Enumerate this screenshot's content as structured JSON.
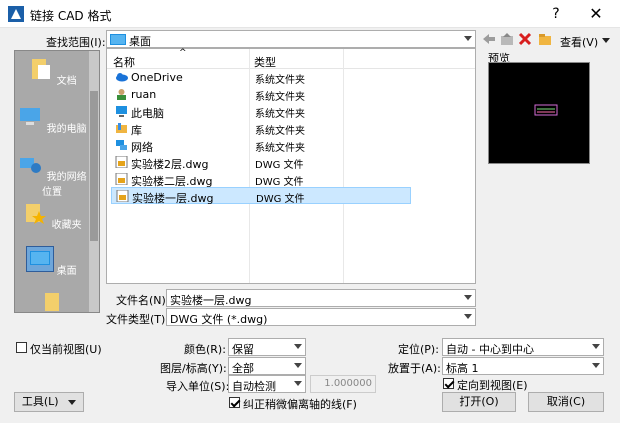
{
  "window": {
    "title": "链接 CAD 格式",
    "help": "?",
    "close": "✕"
  },
  "lookin": {
    "label": "查找范围(I):",
    "value": "桌面",
    "views_label": "查看(V)",
    "preview_label": "预览"
  },
  "places": [
    {
      "label": "文档",
      "icon": "documents-icon"
    },
    {
      "label": "我的电脑",
      "icon": "computer-icon"
    },
    {
      "label": "我的网络位置",
      "icon": "network-icon"
    },
    {
      "label": "收藏夹",
      "icon": "favorites-icon"
    },
    {
      "label": "桌面",
      "icon": "desktop-icon"
    }
  ],
  "files": {
    "col_name": "名称",
    "col_type": "类型",
    "rows": [
      {
        "name": "OneDrive",
        "type": "系统文件夹",
        "icon": "onedrive-icon"
      },
      {
        "name": "ruan",
        "type": "系统文件夹",
        "icon": "user-icon"
      },
      {
        "name": "此电脑",
        "type": "系统文件夹",
        "icon": "thispc-icon"
      },
      {
        "name": "库",
        "type": "系统文件夹",
        "icon": "library-icon"
      },
      {
        "name": "网络",
        "type": "系统文件夹",
        "icon": "network-icon"
      },
      {
        "name": "实验楼2层.dwg",
        "type": "DWG 文件",
        "icon": "dwg-icon"
      },
      {
        "name": "实验楼二层.dwg",
        "type": "DWG 文件",
        "icon": "dwg-icon"
      },
      {
        "name": "实验楼一层.dwg",
        "type": "DWG 文件",
        "icon": "dwg-icon",
        "selected": true
      }
    ]
  },
  "filename": {
    "label": "文件名(N):",
    "value": "实验楼一层.dwg"
  },
  "filetype": {
    "label": "文件类型(T):",
    "value": "DWG 文件 (*.dwg)"
  },
  "options": {
    "current_view_label": "仅当前视图(U)",
    "current_view_checked": false,
    "color_label": "颜色(R):",
    "color_value": "保留",
    "layers_label": "图层/标高(Y):",
    "layers_value": "全部",
    "units_label": "导入单位(S):",
    "units_value": "自动检测",
    "scale_value": "1.000000",
    "correct_lines_label": "纠正稍微偏离轴的线(F)",
    "correct_lines_checked": true,
    "position_label": "定位(P):",
    "position_value": "自动 - 中心到中心",
    "place_at_label": "放置于(A):",
    "place_at_value": "标高 1",
    "orient_label": "定向到视图(E)",
    "orient_checked": true
  },
  "buttons": {
    "tools": "工具(L)",
    "open": "打开(O)",
    "cancel": "取消(C)"
  }
}
